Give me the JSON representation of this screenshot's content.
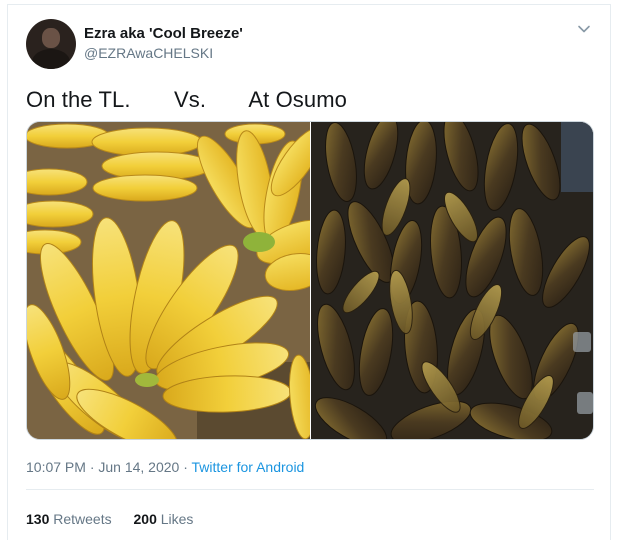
{
  "tweet": {
    "author_name": "Ezra aka 'Cool Breeze'",
    "author_handle": "@EZRAwaCHELSKI",
    "text": "On the TL.       Vs.       At Osumo",
    "timestamp": "10:07 PM · Jun 14, 2020 · ",
    "source": "Twitter for Android",
    "retweets_count": "130",
    "retweets_label": "Retweets",
    "likes_count": "200",
    "likes_label": "Likes"
  },
  "icons": {
    "menu": "chevron-down-icon"
  },
  "colors": {
    "link": "#1b95e0",
    "secondary_text": "#657786",
    "primary_text": "#14171a",
    "border": "#e6ecf0"
  }
}
